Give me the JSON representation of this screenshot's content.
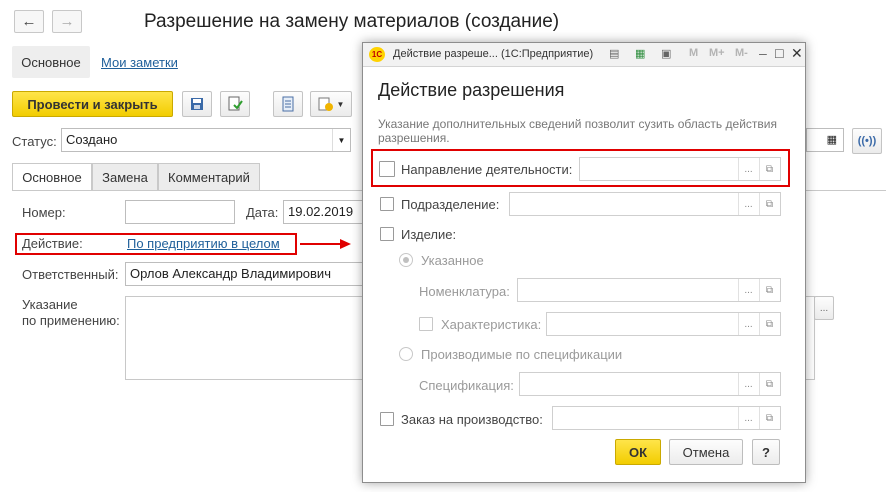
{
  "main": {
    "back_icon": "left-arrow-icon",
    "forward_icon": "right-arrow-icon",
    "back_glyph": "←",
    "forward_glyph": "→",
    "title": "Разрешение на замену материалов (создание)",
    "tab_main": "Основное",
    "link_notes": "Мои заметки",
    "post_close_label": "Провести и закрыть",
    "status_label": "Статус:",
    "status_value": "Создано",
    "tabs": [
      "Основное",
      "Замена",
      "Комментарий"
    ],
    "number_label": "Номер:",
    "number_value": "",
    "date_label": "Дата:",
    "date_value": "19.02.2019",
    "action_label": "Действие:",
    "action_link": "По предприятию в целом",
    "responsible_label": "Ответственный:",
    "responsible_value": "Орлов Александр Владимирович",
    "usage_label_1": "Указание",
    "usage_label_2": "по применению:",
    "more_glyph": "...",
    "highlight_color": "#e00000",
    "accent_color": "#f5d800"
  },
  "dialog": {
    "title": "Действие разреше... (1С:Предприятие)",
    "logo": "1С",
    "toolbar_m": "M",
    "toolbar_mplus": "M+",
    "toolbar_mminus": "M-",
    "heading": "Действие разрешения",
    "hint": "Указание дополнительных сведений позволит сузить область действия разрешения.",
    "direction_label": "Направление деятельности:",
    "department_label": "Подразделение:",
    "product_label": "Изделие:",
    "specified_label": "Указанное",
    "nomenclature_label": "Номенклатура:",
    "characteristic_label": "Характеристика:",
    "produced_label": "Производимые по спецификации",
    "specification_label": "Спецификация:",
    "order_label": "Заказ на производство:",
    "ok_label": "ОК",
    "cancel_label": "Отмена",
    "help_label": "?",
    "ellipsis": "...",
    "open_glyph": "⧉"
  }
}
